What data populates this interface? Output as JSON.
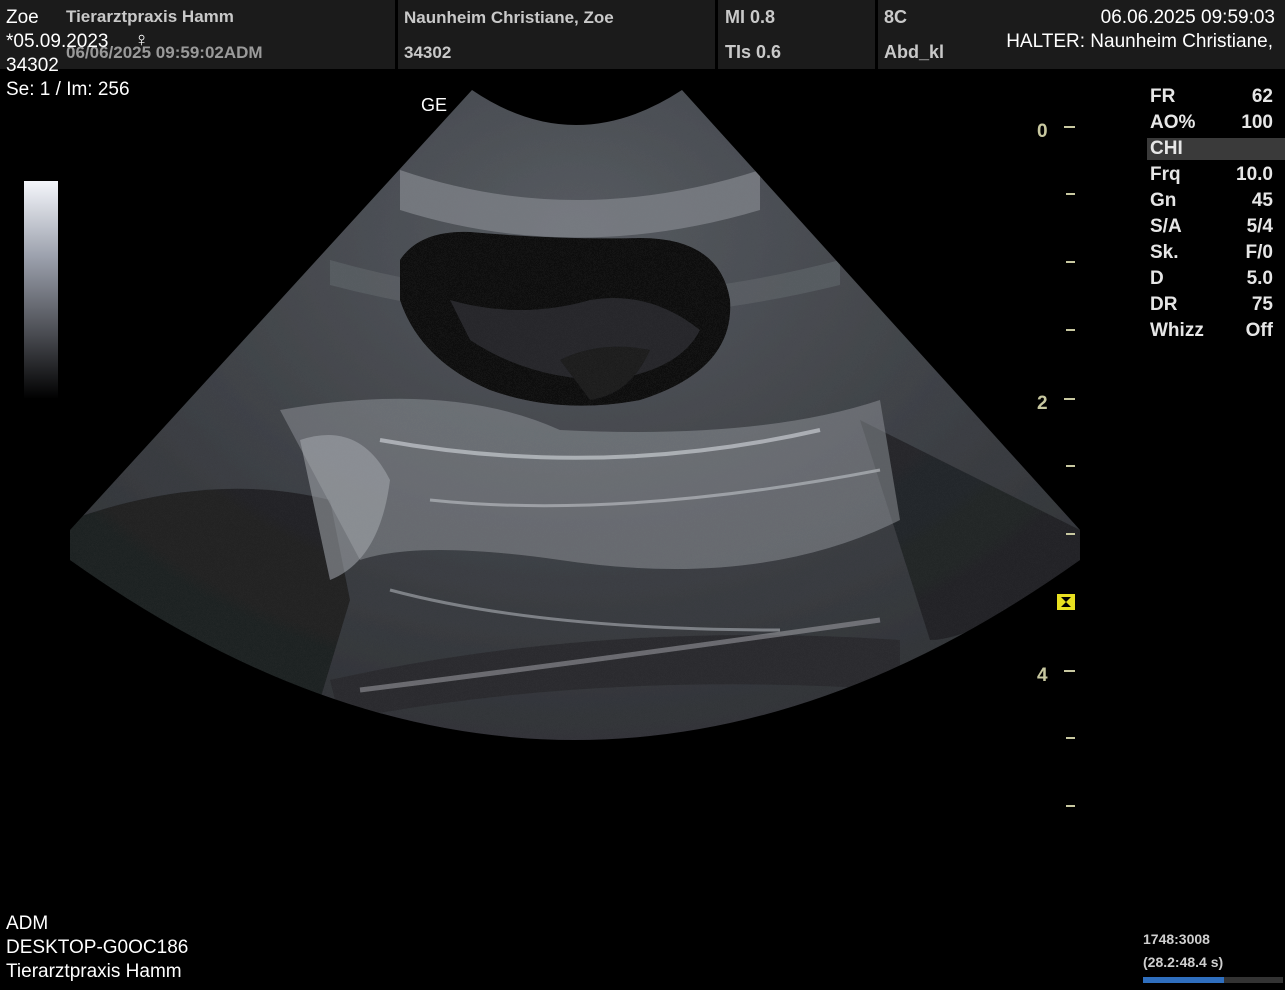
{
  "header": {
    "patient_name": "Zoe",
    "clinic": "Tierarztpraxis Hamm",
    "dob": "*05.09.2023",
    "sex_symbol": "♀",
    "exam_stamp": "06/06/2025 09:59:02ADM",
    "patient_id": "34302",
    "owner_line": "Naunheim Christiane, Zoe",
    "owner_id": "34302",
    "mi": "MI 0.8",
    "tis": "TIs 0.6",
    "probe": "8C",
    "preset": "Abd_kl",
    "datetime": "06.06.2025 09:59:03",
    "owner_full": "HALTER:  Naunheim Christiane,"
  },
  "series": "Se: 1 / Im: 256",
  "probe_marker": "GE",
  "params": [
    {
      "key": "FR",
      "value": "62"
    },
    {
      "key": "AO%",
      "value": "100"
    },
    {
      "key": "CHI",
      "value": ""
    },
    {
      "key": "Frq",
      "value": "10.0"
    },
    {
      "key": "Gn",
      "value": "45"
    },
    {
      "key": "S/A",
      "value": "5/4"
    },
    {
      "key": "Sk.",
      "value": "F/0"
    },
    {
      "key": "D",
      "value": "5.0"
    },
    {
      "key": "DR",
      "value": "75"
    },
    {
      "key": "Whizz",
      "value": "Off"
    }
  ],
  "depth_labels": [
    "0",
    "2",
    "4"
  ],
  "footer": {
    "user": "ADM",
    "host": "DESKTOP-G0OC186",
    "clinic": "Tierarztpraxis Hamm",
    "frame": "1748:3008",
    "time": "(28.2:48.4 s)",
    "cine_progress": 0.58
  },
  "colors": {
    "header_bg": "#1b1b1b",
    "scale": "#c8c8a0",
    "focus": "#e8e020",
    "cine_bar": "#2f6fbf"
  }
}
